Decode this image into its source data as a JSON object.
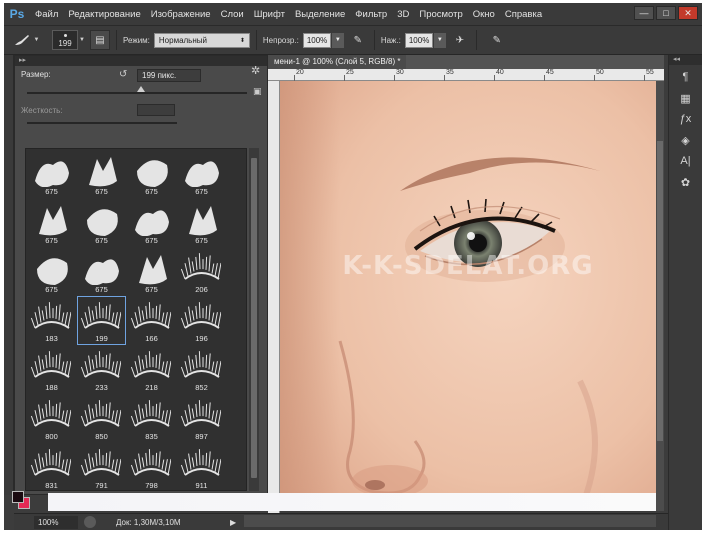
{
  "app": {
    "logo": "Ps"
  },
  "menu": [
    "Файл",
    "Редактирование",
    "Изображение",
    "Слои",
    "Шрифт",
    "Выделение",
    "Фильтр",
    "3D",
    "Просмотр",
    "Окно",
    "Справка"
  ],
  "window_controls": {
    "minimize": "—",
    "maximize": "□",
    "close": "✕"
  },
  "options": {
    "brush_size": "199",
    "mode_label": "Режим:",
    "mode_value": "Нормальный",
    "opacity_label": "Непрозр.:",
    "opacity_value": "100%",
    "flow_label": "Наж.:",
    "flow_value": "100%"
  },
  "document": {
    "tab_title": "мени-1 @ 100% (Слой 5, RGB/8) *",
    "ruler_labels": [
      "20",
      "25",
      "30",
      "35",
      "40",
      "45",
      "50",
      "55"
    ],
    "watermark": "K-K-SDELAT.ORG"
  },
  "brush_panel": {
    "size_label": "Размер:",
    "size_value": "199 пикс.",
    "size_fraction": 0.52,
    "hardness_label": "Жесткость:",
    "brushes": [
      "675",
      "675",
      "675",
      "675",
      "675",
      "675",
      "675",
      "675",
      "675",
      "675",
      "675",
      "206",
      "183",
      "199",
      "166",
      "196",
      "188",
      "233",
      "218",
      "852",
      "800",
      "850",
      "835",
      "897",
      "831",
      "791",
      "798",
      "911",
      "",
      "",
      "",
      ""
    ],
    "selected_brush": "199"
  },
  "colors": {
    "foreground": "#1a0a10",
    "background": "#e32a55"
  },
  "status": {
    "zoom": "100%",
    "doc_info": "Док: 1,30M/3,10M",
    "arrow": "▶"
  }
}
